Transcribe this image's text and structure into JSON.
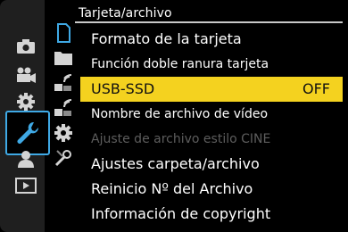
{
  "header": {
    "title": "Tarjeta/archivo"
  },
  "left_menu": [
    {
      "icon": "camera-icon"
    },
    {
      "icon": "video-camera-icon"
    },
    {
      "icon": "custom-gear-icon"
    },
    {
      "icon": "setup-wrench-icon",
      "selected": true
    },
    {
      "icon": "my-menu-person-icon"
    },
    {
      "icon": "playback-icon"
    }
  ],
  "sub_tabs": [
    {
      "icon": "card-icon",
      "selected": true
    },
    {
      "icon": "folder-icon"
    },
    {
      "icon": "monitor-signal-icon"
    },
    {
      "icon": "lan-signal-icon"
    },
    {
      "icon": "settings-gear-icon"
    },
    {
      "icon": "tools-icon"
    }
  ],
  "menu": {
    "items": [
      {
        "label": "Formato de la tarjeta"
      },
      {
        "label": "Función doble ranura tarjeta"
      },
      {
        "label": "USB-SSD",
        "value": "OFF"
      },
      {
        "label": "Nombre de archivo de vídeo"
      },
      {
        "label": "Ajuste de archivo estilo CINE"
      },
      {
        "label": "Ajustes carpeta/archivo"
      },
      {
        "label": "Reinicio Nº del Archivo"
      },
      {
        "label": "Información de copyright"
      }
    ]
  },
  "colors": {
    "accent": "#3fa9e5",
    "highlight": "#f4d21f",
    "disabled": "#5d5d5d"
  }
}
